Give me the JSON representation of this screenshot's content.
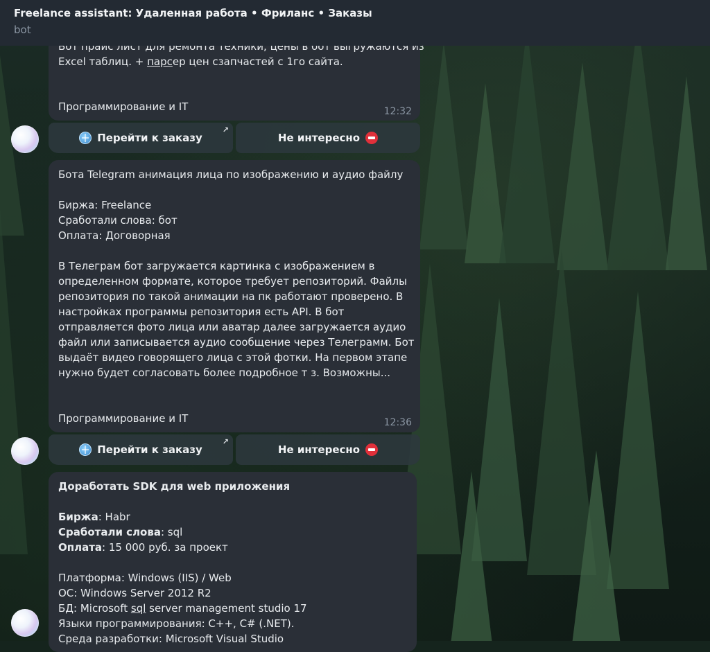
{
  "header": {
    "title": "Freelance assistant: Удаленная работа • Фриланс • Заказы",
    "subtitle": "bot"
  },
  "buttons": {
    "open_order": "Перейти к заказу",
    "not_interested": "Не интересно"
  },
  "messages": [
    {
      "partial_lines": [
        "Бот прайс лист для ремонта техники, цены в бот выгружаются из",
        "Excel таблиц. + ",
        "парс",
        "ер цен сзапчастей с 1го сайта."
      ],
      "category": "Программирование и IT",
      "time": "12:32"
    },
    {
      "title": "Бота Telegram анимация лица по изображению и аудио файлу",
      "meta": [
        "Биржа: Freelance",
        "Сработали слова: бот",
        "Оплата: Договорная"
      ],
      "body": [
        "В Телеграм бот загружается картинка с изображением в",
        "определенном формате, которое требует репозиторий. Файлы",
        "репозитория по такой анимации на пк работают проверено. В",
        "настройках программы репозитория есть API. В бот",
        "отправляется фото лица или аватар далее загружается аудио",
        "файл или записывается аудио сообщение через Телеграмм. Бот",
        "выдаёт видео говорящего лица с этой фотки. На первом этапе",
        "нужно будет согласовать более подробное т з. Возможны..."
      ],
      "category": "Программирование и IT",
      "time": "12:36"
    },
    {
      "title": "Доработать SDK для web приложения",
      "meta": [
        {
          "label": "Биржа",
          "value": ": Habr"
        },
        {
          "label": "Сработали слова",
          "value": ": sql"
        },
        {
          "label": "Оплата",
          "value": ": 15 000 руб. за проект"
        }
      ],
      "body": [
        "Платформа: Windows (IIS) / Web",
        "ОС: Windows Server 2012 R2",
        "БД: Microsoft ",
        "sql",
        " server management studio 17",
        "Языки программирования: C++, C# (.NET).",
        "Среда разработки: Microsoft Visual Studio"
      ]
    }
  ]
}
